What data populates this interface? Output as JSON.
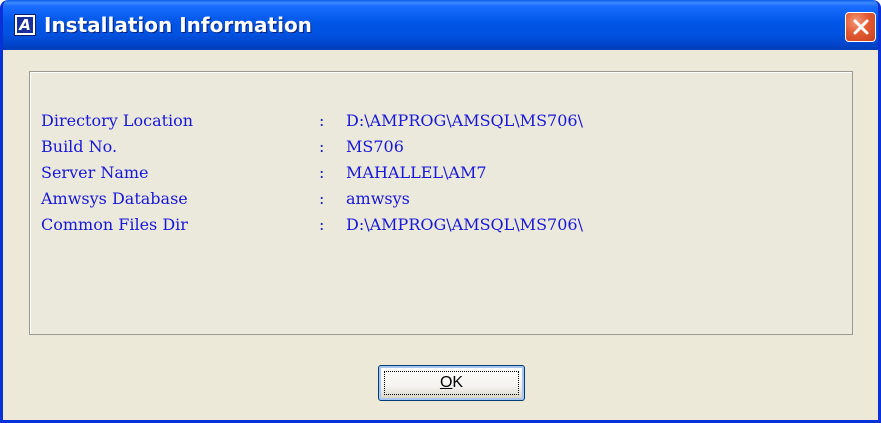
{
  "window": {
    "title": "Installation Information",
    "app_icon_letter": "A"
  },
  "info": {
    "rows": [
      {
        "label": "Directory Location",
        "separator": ":",
        "value": "D:\\AMPROG\\AMSQL\\MS706\\"
      },
      {
        "label": "Build No.",
        "separator": ":",
        "value": "MS706"
      },
      {
        "label": "Server Name",
        "separator": ":",
        "value": "MAHALLEL\\AM7"
      },
      {
        "label": "Amwsys Database",
        "separator": ":",
        "value": "amwsys"
      },
      {
        "label": "Common Files Dir",
        "separator": ":",
        "value": "D:\\AMPROG\\AMSQL\\MS706\\"
      }
    ]
  },
  "ok_button": {
    "mnemonic": "O",
    "rest": "K"
  },
  "colors": {
    "title_bar": "#0054e3",
    "window_bg": "#ece9d8",
    "info_text": "#1818d8",
    "close_button": "#e35a32"
  }
}
